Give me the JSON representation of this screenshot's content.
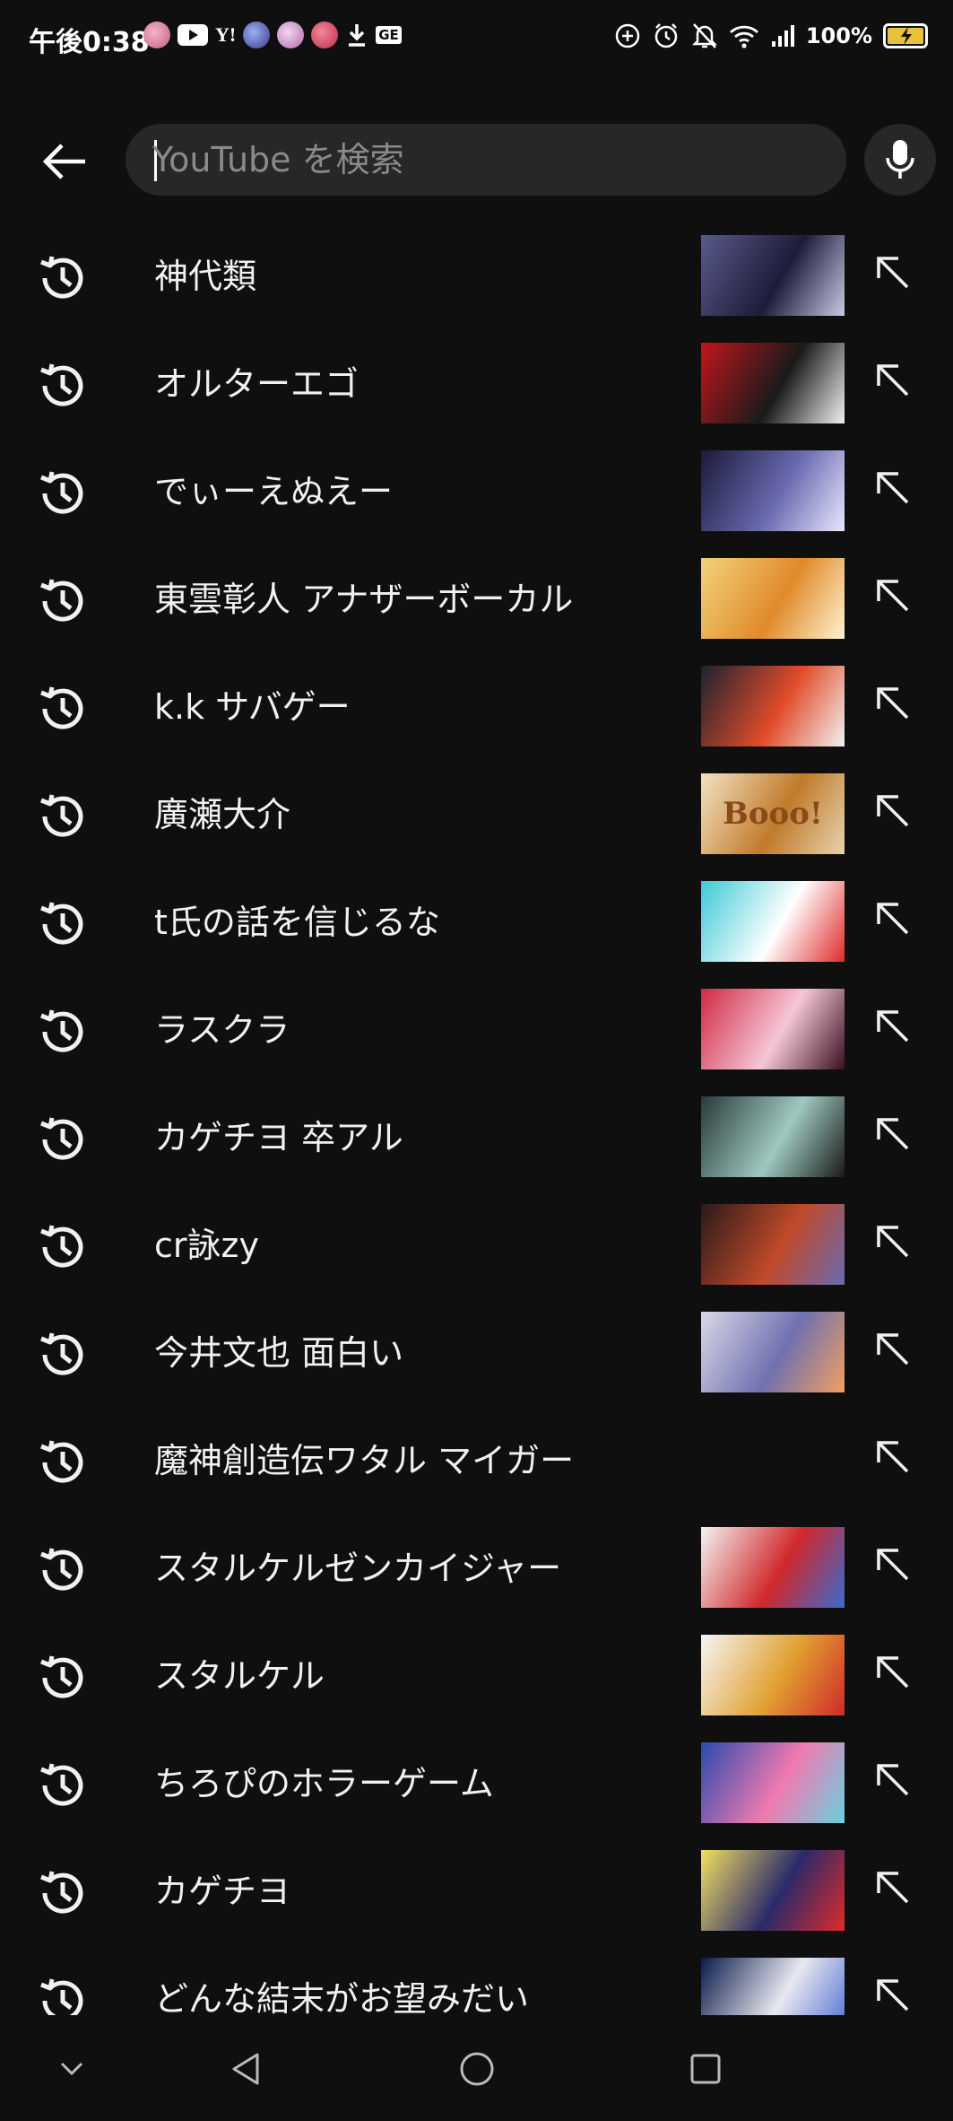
{
  "status_bar": {
    "time": "午後0:38",
    "app_icons": [
      "app-icon",
      "youtube-icon",
      "yahoo-icon",
      "app-icon",
      "app-icon",
      "app-icon",
      "download-icon",
      "ge-icon"
    ],
    "yahoo_text": "Y!",
    "ge_text": "GE",
    "battery": "100%",
    "right_icons": [
      "add-circle-icon",
      "alarm-icon",
      "mute-bell-icon",
      "wifi-icon",
      "signal-icon",
      "battery-charging-icon"
    ]
  },
  "search": {
    "placeholder": "YouTube を検索",
    "value": ""
  },
  "history": [
    {
      "label": "神代類",
      "thumb": [
        "#5a5a8a",
        "#1c1c3a",
        "#c9c9e6"
      ]
    },
    {
      "label": "オルターエゴ",
      "thumb": [
        "#c0161d",
        "#1a1a1a",
        "#f2f2f2"
      ]
    },
    {
      "label": "でぃーえぬえー",
      "thumb": [
        "#1a1a3a",
        "#6a6ab0",
        "#e8e8ff"
      ]
    },
    {
      "label": "東雲彰人 アナザーボーカル",
      "thumb": [
        "#f3d27a",
        "#e08a2a",
        "#fff3d0"
      ]
    },
    {
      "label": "k.k サバゲー",
      "thumb": [
        "#1c2230",
        "#e24c2a",
        "#f2f2f2"
      ]
    },
    {
      "label": "廣瀬大介",
      "thumb": [
        "#f3e2c4",
        "#c07a2a",
        "#e6d3b0"
      ],
      "thumb_text": "Booo!"
    },
    {
      "label": "t氏の話を信じるな",
      "thumb": [
        "#3ec9d6",
        "#ffffff",
        "#e02a2a"
      ]
    },
    {
      "label": "ラスクラ",
      "thumb": [
        "#d02a44",
        "#f6c6d6",
        "#3a1020"
      ]
    },
    {
      "label": "カゲチヨ 卒アル",
      "thumb": [
        "#2a3a3a",
        "#9ec9c0",
        "#1a1a1a"
      ]
    },
    {
      "label": "cr詠zy",
      "thumb": [
        "#2a1a1a",
        "#c04a2a",
        "#6a6ab0"
      ]
    },
    {
      "label": "今井文也 面白い",
      "thumb": [
        "#d8d8e8",
        "#7070b0",
        "#f0a060"
      ]
    },
    {
      "label": "魔神創造伝ワタル マイガー",
      "thumb": null
    },
    {
      "label": "スタルケルゼンカイジャー",
      "thumb": [
        "#f4f4f4",
        "#d0282a",
        "#3a6ad0"
      ]
    },
    {
      "label": "スタルケル",
      "thumb": [
        "#f6f6f6",
        "#e0a030",
        "#d02a2a"
      ]
    },
    {
      "label": "ちろぴのホラーゲーム",
      "thumb": [
        "#2a4ab0",
        "#f07ab0",
        "#6ad0e0"
      ]
    },
    {
      "label": "カゲチヨ",
      "thumb": [
        "#f4e060",
        "#2a2a6a",
        "#e02a2a"
      ]
    },
    {
      "label": "どんな結末がお望みだい",
      "thumb": [
        "#0a1a4a",
        "#e8e8f0",
        "#4a6ad0"
      ]
    }
  ],
  "nav": {
    "icons": [
      "chevron-down-icon",
      "back-triangle-icon",
      "home-circle-icon",
      "recents-square-icon"
    ]
  }
}
